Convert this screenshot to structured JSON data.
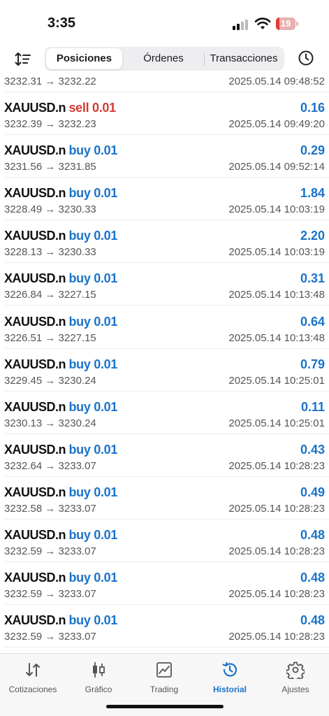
{
  "status_bar": {
    "time": "3:35",
    "battery": "19",
    "battery_level": 0.19
  },
  "header": {
    "tabs": [
      {
        "label": "Posiciones",
        "active": true
      },
      {
        "label": "Órdenes",
        "active": false
      },
      {
        "label": "Transacciones",
        "active": false
      }
    ],
    "sort_icon": "sort-icon",
    "history_icon": "clock-icon"
  },
  "colors": {
    "buy": "#1a73c9",
    "sell": "#d43a2f",
    "profit": "#1a73c9",
    "active_tab": "#1a73c9"
  },
  "partial_row": {
    "prices": "3232.31 → 3232.22",
    "datetime": "2025.05.14 09:48:52"
  },
  "trades": [
    {
      "symbol": "XAUUSD.n",
      "side": "sell 0.01",
      "type": "sell",
      "profit": "0.16",
      "prices": "3232.39 → 3232.23",
      "datetime": "2025.05.14 09:49:20"
    },
    {
      "symbol": "XAUUSD.n",
      "side": "buy 0.01",
      "type": "buy",
      "profit": "0.29",
      "prices": "3231.56 → 3231.85",
      "datetime": "2025.05.14 09:52:14"
    },
    {
      "symbol": "XAUUSD.n",
      "side": "buy 0.01",
      "type": "buy",
      "profit": "1.84",
      "prices": "3228.49 → 3230.33",
      "datetime": "2025.05.14 10:03:19"
    },
    {
      "symbol": "XAUUSD.n",
      "side": "buy 0.01",
      "type": "buy",
      "profit": "2.20",
      "prices": "3228.13 → 3230.33",
      "datetime": "2025.05.14 10:03:19"
    },
    {
      "symbol": "XAUUSD.n",
      "side": "buy 0.01",
      "type": "buy",
      "profit": "0.31",
      "prices": "3226.84 → 3227.15",
      "datetime": "2025.05.14 10:13:48"
    },
    {
      "symbol": "XAUUSD.n",
      "side": "buy 0.01",
      "type": "buy",
      "profit": "0.64",
      "prices": "3226.51 → 3227.15",
      "datetime": "2025.05.14 10:13:48"
    },
    {
      "symbol": "XAUUSD.n",
      "side": "buy 0.01",
      "type": "buy",
      "profit": "0.79",
      "prices": "3229.45 → 3230.24",
      "datetime": "2025.05.14 10:25:01"
    },
    {
      "symbol": "XAUUSD.n",
      "side": "buy 0.01",
      "type": "buy",
      "profit": "0.11",
      "prices": "3230.13 → 3230.24",
      "datetime": "2025.05.14 10:25:01"
    },
    {
      "symbol": "XAUUSD.n",
      "side": "buy 0.01",
      "type": "buy",
      "profit": "0.43",
      "prices": "3232.64 → 3233.07",
      "datetime": "2025.05.14 10:28:23"
    },
    {
      "symbol": "XAUUSD.n",
      "side": "buy 0.01",
      "type": "buy",
      "profit": "0.49",
      "prices": "3232.58 → 3233.07",
      "datetime": "2025.05.14 10:28:23"
    },
    {
      "symbol": "XAUUSD.n",
      "side": "buy 0.01",
      "type": "buy",
      "profit": "0.48",
      "prices": "3232.59 → 3233.07",
      "datetime": "2025.05.14 10:28:23"
    },
    {
      "symbol": "XAUUSD.n",
      "side": "buy 0.01",
      "type": "buy",
      "profit": "0.48",
      "prices": "3232.59 → 3233.07",
      "datetime": "2025.05.14 10:28:23"
    },
    {
      "symbol": "XAUUSD.n",
      "side": "buy 0.01",
      "type": "buy",
      "profit": "0.48",
      "prices": "3232.59 → 3233.07",
      "datetime": "2025.05.14 10:28:23"
    }
  ],
  "tabbar": [
    {
      "label": "Cotizaciones",
      "icon": "quotes-arrows-icon",
      "active": false
    },
    {
      "label": "Gráfico",
      "icon": "candlestick-chart-icon",
      "active": false
    },
    {
      "label": "Trading",
      "icon": "trading-chart-icon",
      "active": false
    },
    {
      "label": "Historial",
      "icon": "history-icon",
      "active": true
    },
    {
      "label": "Ajustes",
      "icon": "settings-gear-icon",
      "active": false
    }
  ]
}
